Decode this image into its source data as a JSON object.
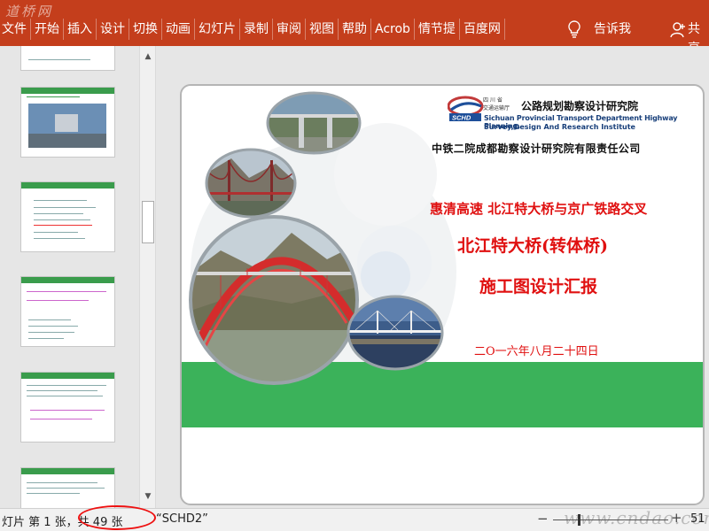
{
  "watermark_top": "道桥网",
  "ribbon": {
    "tabs": [
      "文件",
      "开始",
      "插入",
      "设计",
      "切换",
      "动画",
      "幻灯片",
      "录制",
      "审阅",
      "视图",
      "帮助",
      "Acrob",
      "情节提",
      "百度网"
    ],
    "tell_me": "告诉我",
    "share": "共享"
  },
  "slide": {
    "institute_small_1": "四 川 省",
    "institute_small_2": "交通运输厅",
    "institute_name": "公路规划勘察设计研究院",
    "institute_en_1": "Sichuan Provincial Transport Department Highway Planning,",
    "institute_en_2": "Survey,Design And Research Institute",
    "logo_text": "SCHD",
    "company": "中铁二院成都勘察设计研究院有限责任公司",
    "subtitle": "惠清高速 北江特大桥与京广铁路交叉",
    "title_1": "北江特大桥(转体桥)",
    "title_2": "施工图设计汇报",
    "date": "二O一六年八月二十四日"
  },
  "status": {
    "slide_count": "灯片 第 1 张，共 49 张",
    "theme": "“SCHD2”",
    "zoom_minus": "−",
    "zoom_plus": "+",
    "zoom_level": "51",
    "watermark": "www.cndao.com"
  },
  "colors": {
    "ribbon": "#c43e1c",
    "title_red": "#e01010",
    "band_green": "#3bb25a"
  }
}
